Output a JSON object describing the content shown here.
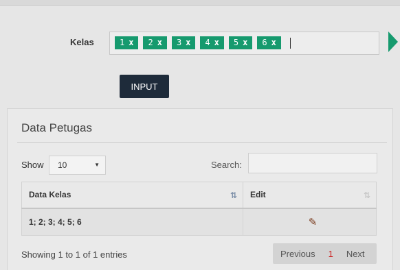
{
  "form": {
    "kelas_label": "Kelas",
    "tags": [
      {
        "label": "1",
        "remove": "x"
      },
      {
        "label": "2",
        "remove": "x"
      },
      {
        "label": "3",
        "remove": "x"
      },
      {
        "label": "4",
        "remove": "x"
      },
      {
        "label": "5",
        "remove": "x"
      },
      {
        "label": "6",
        "remove": "x"
      }
    ],
    "input_button": "INPUT"
  },
  "panel": {
    "title": "Data Petugas",
    "show_label": "Show",
    "page_length": "10",
    "search_label": "Search:",
    "search_value": "",
    "columns": [
      "Data Kelas",
      "Edit"
    ],
    "rows": [
      {
        "data_kelas": "1; 2; 3; 4; 5; 6",
        "edit_icon": "pencil-icon"
      }
    ],
    "info": "Showing 1 to 1 of 1 entries",
    "pagination": {
      "previous": "Previous",
      "current": "1",
      "next": "Next"
    }
  },
  "colors": {
    "tag": "#169a6e",
    "button": "#1e2b3a",
    "current_page": "#cc1f1f"
  }
}
